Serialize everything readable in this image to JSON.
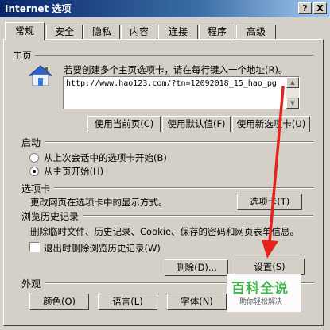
{
  "window": {
    "title": "Internet 选项",
    "help": "?",
    "close": "X"
  },
  "tabs": [
    "常规",
    "安全",
    "隐私",
    "内容",
    "连接",
    "程序",
    "高级"
  ],
  "homepage": {
    "section": "主页",
    "instruction": "若要创建多个主页选项卡，请在每行键入一个地址(R)。",
    "url": "http://www.hao123.com/?tn=12092018_15_hao_pg",
    "btn_current": "使用当前页(C)",
    "btn_default": "使用默认值(F)",
    "btn_newtab": "使用新选项卡(U)"
  },
  "startup": {
    "section": "启动",
    "option1": "从上次会话中的选项卡开始(B)",
    "option2": "从主页开始(H)",
    "selected": "option2"
  },
  "tabs_section": {
    "section": "选项卡",
    "desc": "更改网页在选项卡中的显示方式。",
    "btn": "选项卡(T)"
  },
  "history": {
    "section": "浏览历史记录",
    "desc": "删除临时文件、历史记录、Cookie、保存的密码和网页表单信息。",
    "checkbox": "退出时删除浏览历史记录(W)",
    "btn_delete": "删除(D)...",
    "btn_settings": "设置(S)"
  },
  "appearance": {
    "section": "外观",
    "btn_colors": "颜色(O)",
    "btn_languages": "语言(L)",
    "btn_fonts": "字体(N)"
  },
  "watermark": {
    "title": "百科全说",
    "subtitle": "助你轻松解决"
  },
  "colors": {
    "titlebar": "#0a246a",
    "arrow": "#e5231d",
    "watermark_green": "#3cb34a"
  }
}
